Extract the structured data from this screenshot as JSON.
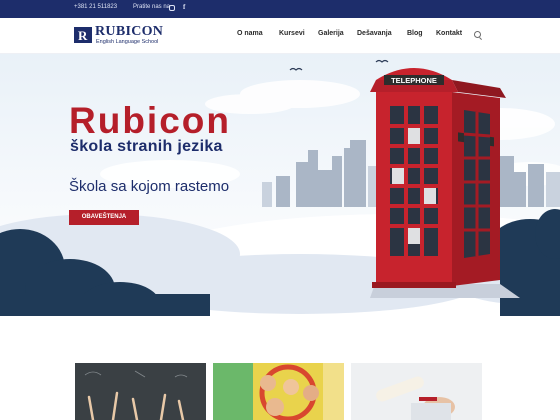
{
  "topbar": {
    "phone": "+381 21 511823",
    "follow_label": "Pratite nas na"
  },
  "logo": {
    "mark": "R",
    "title": "RUBICON",
    "subtitle": "English Language School"
  },
  "nav": {
    "items": [
      {
        "label": "O nama"
      },
      {
        "label": "Kursevi"
      },
      {
        "label": "Galerija"
      },
      {
        "label": "Dešavanja"
      },
      {
        "label": "Blog"
      },
      {
        "label": "Kontakt"
      }
    ]
  },
  "hero": {
    "title": "Rubicon",
    "subtitle": "škola stranih jezika",
    "tagline": "Škola sa kojom rastemo",
    "button_label": "OBAVEŠTENJA",
    "booth_sign": "TELEPHONE"
  },
  "icons": {
    "instagram": "instagram-icon",
    "facebook": "facebook-icon",
    "search": "search-icon"
  },
  "colors": {
    "brand_navy": "#1d2d6b",
    "brand_red": "#b51f2a"
  }
}
